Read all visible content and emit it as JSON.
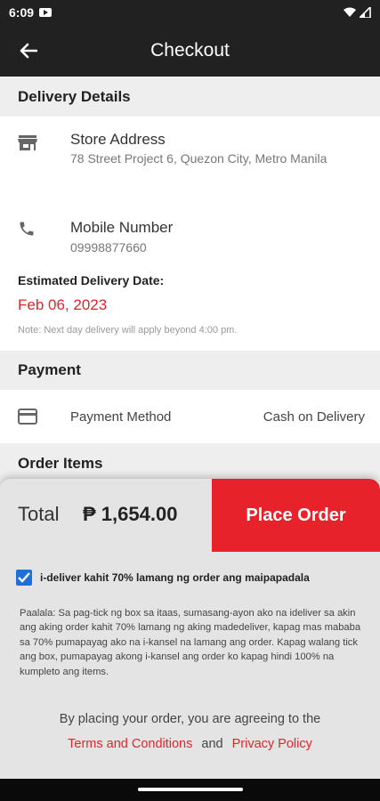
{
  "status_bar": {
    "time": "6:09",
    "icons": [
      "youtube-icon",
      "wifi-icon",
      "signal-icon"
    ]
  },
  "app_bar": {
    "title": "Checkout",
    "back_icon": "arrow-left-icon"
  },
  "delivery": {
    "header": "Delivery Details",
    "store": {
      "icon": "store-icon",
      "title": "Store Address",
      "address": "78 Street  Project 6, Quezon City, Metro Manila"
    },
    "mobile": {
      "icon": "phone-icon",
      "title": "Mobile Number",
      "number": "09998877660"
    },
    "estimate": {
      "label": "Estimated Delivery Date:",
      "date": "Feb 06, 2023",
      "note": "Note: Next day delivery will apply beyond 4:00 pm."
    }
  },
  "payment": {
    "header": "Payment",
    "icon": "credit-card-icon",
    "label": "Payment Method",
    "value": "Cash on Delivery"
  },
  "order_items": {
    "header": "Order Items"
  },
  "summary": {
    "total_label": "Total",
    "total_value": "₱ 1,654.00",
    "place_order_label": "Place Order",
    "partial_delivery_checked": true,
    "partial_delivery_label": "i-deliver kahit 70% lamang ng order ang maipapadala",
    "paalala": "Paalala: Sa pag-tick ng box sa itaas, sumasang-ayon ako na ideliver sa akin ang aking order kahit 70% lamang ng aking madedeliver, kapag mas mababa sa 70% pumapayag ako na i-kansel na lamang ang order. Kapag walang tick ang box, pumapayag akong i-kansel ang order ko kapag hindi 100% na kumpleto ang items.",
    "agree_text": "By placing your order, you are agreeing to the",
    "terms_label": "Terms and Conditions",
    "and_text": "and",
    "privacy_label": "Privacy Policy"
  },
  "colors": {
    "accent": "#e8222a",
    "dark": "#212121",
    "checkbox": "#1e6fd6"
  }
}
